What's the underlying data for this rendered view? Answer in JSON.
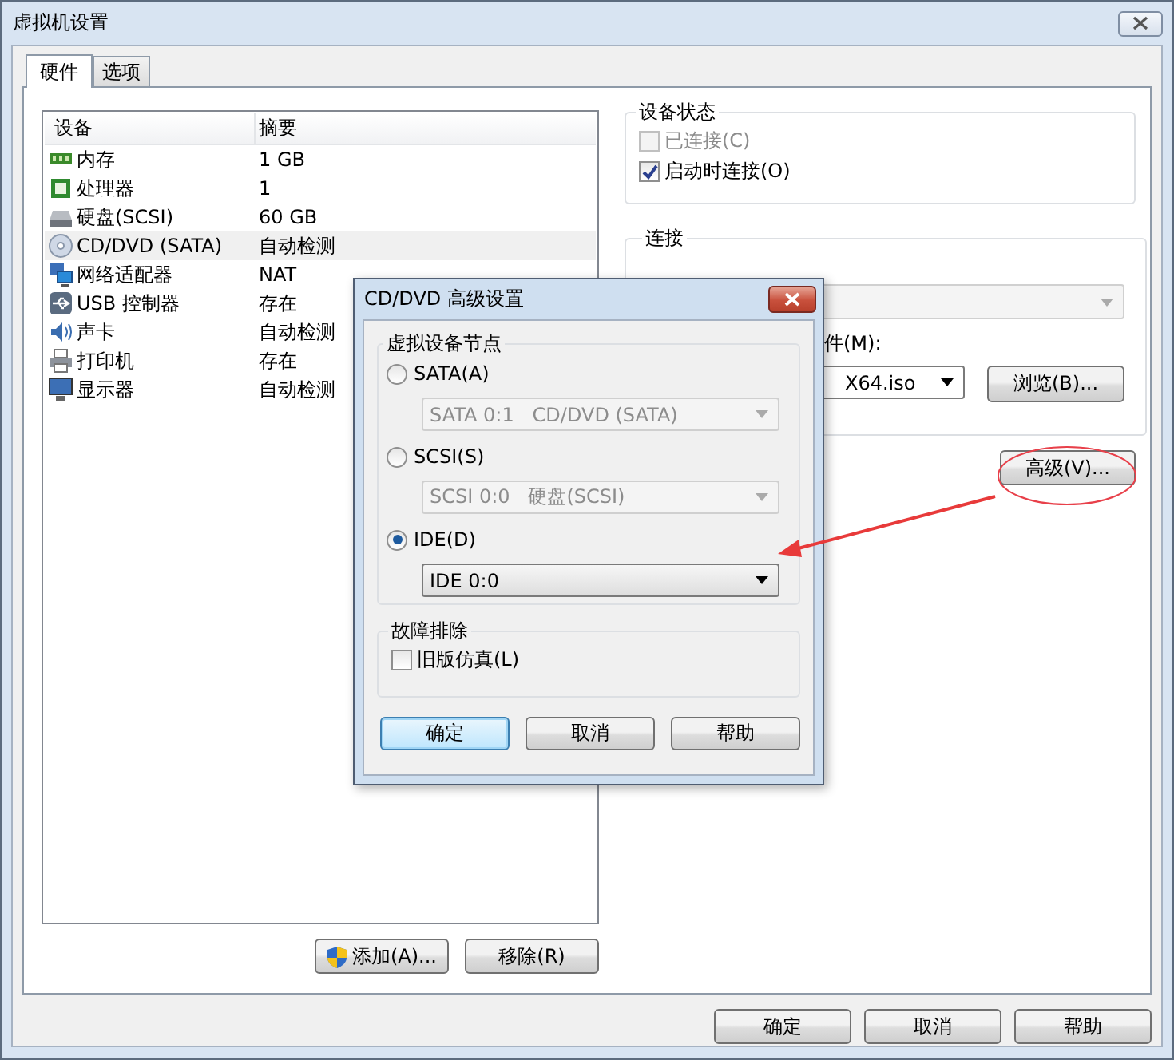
{
  "window": {
    "title": "虚拟机设置"
  },
  "tabs": [
    {
      "label": "硬件",
      "selected": true
    },
    {
      "label": "选项",
      "selected": false
    }
  ],
  "device_table": {
    "columns": [
      "设备",
      "摘要"
    ],
    "rows": [
      {
        "kind": "memory",
        "device": "内存",
        "summary": "1 GB",
        "selected": false
      },
      {
        "kind": "cpu",
        "device": "处理器",
        "summary": "1",
        "selected": false
      },
      {
        "kind": "disk",
        "device": "硬盘(SCSI)",
        "summary": "60 GB",
        "selected": false
      },
      {
        "kind": "cd",
        "device": "CD/DVD (SATA)",
        "summary": "自动检测",
        "selected": true
      },
      {
        "kind": "network",
        "device": "网络适配器",
        "summary": "NAT",
        "selected": false
      },
      {
        "kind": "usb",
        "device": "USB 控制器",
        "summary": "存在",
        "selected": false
      },
      {
        "kind": "sound",
        "device": "声卡",
        "summary": "自动检测",
        "selected": false
      },
      {
        "kind": "printer",
        "device": "打印机",
        "summary": "存在",
        "selected": false
      },
      {
        "kind": "display",
        "device": "显示器",
        "summary": "自动检测",
        "selected": false
      }
    ]
  },
  "device_buttons": [
    {
      "kind": "shield",
      "label": "添加(A)..."
    },
    {
      "kind": "plain",
      "label": "移除(R)"
    }
  ],
  "device_status": {
    "title": "设备状态",
    "options": [
      {
        "label": "已连接(C)",
        "checked": false,
        "disabled": true
      },
      {
        "label": "启动时连接(O)",
        "checked": true,
        "disabled": false
      }
    ]
  },
  "connection": {
    "title": "连接",
    "iso_label": "件(M):",
    "iso_value": "X64.iso",
    "browse_button": "浏览(B)..."
  },
  "advanced_button": "高级(V)...",
  "footer_buttons": [
    "确定",
    "取消",
    "帮助"
  ],
  "dialog": {
    "title": "CD/DVD 高级设置",
    "node_group": {
      "title": "虚拟设备节点",
      "options": [
        {
          "label": "SATA(A)",
          "selected": false,
          "value": "SATA 0:1   CD/DVD (SATA)"
        },
        {
          "label": "SCSI(S)",
          "selected": false,
          "value": "SCSI 0:0   硬盘(SCSI)"
        },
        {
          "label": "IDE(D)",
          "selected": true,
          "value": "IDE 0:0"
        }
      ]
    },
    "troubleshoot": {
      "title": "故障排除",
      "option": {
        "label": "旧版仿真(L)",
        "checked": false
      }
    },
    "buttons": [
      {
        "label": "确定",
        "default": true
      },
      {
        "label": "取消",
        "default": false
      },
      {
        "label": "帮助",
        "default": false
      }
    ]
  }
}
